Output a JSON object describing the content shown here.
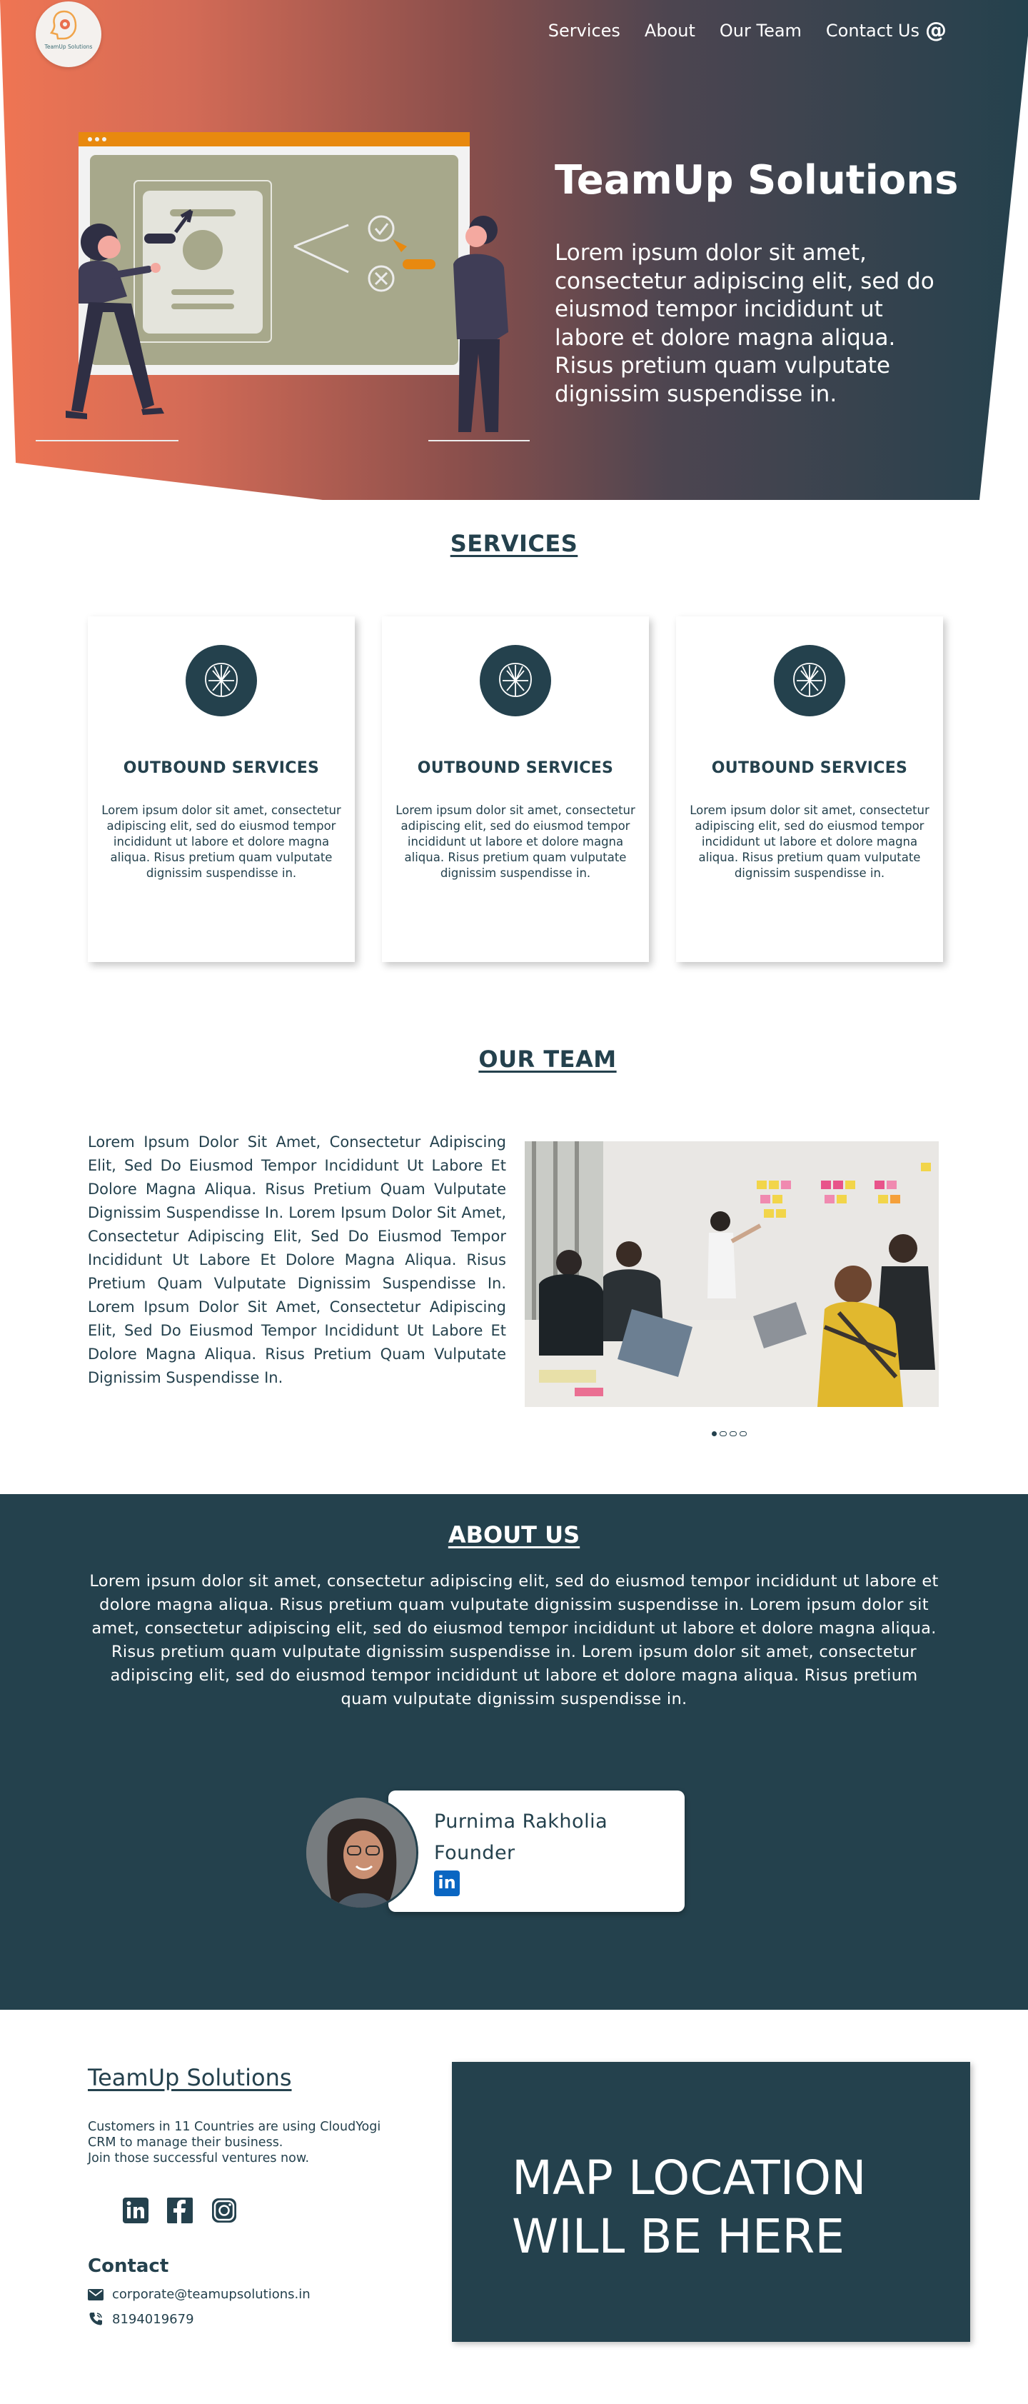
{
  "colors": {
    "primary": "#24414d",
    "accent": "#e96f4f",
    "white": "#ffffff",
    "linkedin": "#0a66c2"
  },
  "brand": {
    "logo_text": "TeamUp Solutions"
  },
  "nav": {
    "items": [
      {
        "label": "Services"
      },
      {
        "label": "About"
      },
      {
        "label": "Our Team"
      },
      {
        "label": "Contact Us"
      }
    ],
    "contact_icon": "at-icon"
  },
  "hero": {
    "title": "TeamUp Solutions",
    "description": "Lorem ipsum dolor sit amet, consectetur adipiscing elit, sed do eiusmod tempor incididunt ut labore et dolore magna aliqua. Risus pretium quam vulputate dignissim suspendisse in."
  },
  "services": {
    "heading": "SERVICES",
    "cards": [
      {
        "icon": "brain-network-icon",
        "title": "OUTBOUND SERVICES",
        "text": "Lorem ipsum dolor sit amet, consectetur adipiscing elit, sed do eiusmod tempor incididunt ut labore et dolore magna aliqua. Risus pretium quam vulputate dignissim suspendisse in."
      },
      {
        "icon": "brain-network-icon",
        "title": "OUTBOUND SERVICES",
        "text": "Lorem ipsum dolor sit amet, consectetur adipiscing elit, sed do eiusmod tempor incididunt ut labore et dolore magna aliqua. Risus pretium quam vulputate dignissim suspendisse in."
      },
      {
        "icon": "brain-network-icon",
        "title": "OUTBOUND SERVICES",
        "text": "Lorem ipsum dolor sit amet, consectetur adipiscing elit, sed do eiusmod tempor incididunt ut labore et dolore magna aliqua. Risus pretium quam vulputate dignissim suspendisse in."
      }
    ]
  },
  "team": {
    "heading": "OUR TEAM",
    "text": "Lorem Ipsum Dolor Sit Amet, Consectetur Adipiscing Elit, Sed Do Eiusmod Tempor Incididunt Ut Labore Et Dolore Magna Aliqua. Risus Pretium Quam Vulputate Dignissim Suspendisse In. Lorem Ipsum Dolor Sit Amet, Consectetur Adipiscing Elit, Sed Do Eiusmod Tempor Incididunt Ut Labore Et Dolore Magna Aliqua. Risus Pretium Quam Vulputate Dignissim Suspendisse In. Lorem Ipsum Dolor Sit Amet, Consectetur Adipiscing Elit, Sed Do Eiusmod Tempor Incididunt Ut Labore Et Dolore Magna Aliqua. Risus Pretium Quam Vulputate Dignissim Suspendisse In.",
    "carousel_slides": 4,
    "carousel_active": 1
  },
  "about": {
    "heading": "ABOUT US",
    "text": "Lorem ipsum dolor sit amet, consectetur adipiscing elit, sed do eiusmod tempor incididunt ut labore et dolore magna aliqua. Risus pretium quam vulputate dignissim suspendisse in. Lorem ipsum dolor sit amet, consectetur adipiscing elit, sed do eiusmod tempor incididunt ut labore et dolore magna aliqua. Risus pretium quam vulputate dignissim suspendisse in. Lorem ipsum dolor sit amet, consectetur adipiscing elit, sed do eiusmod tempor incididunt ut labore et dolore magna aliqua. Risus pretium quam vulputate dignissim suspendisse in.",
    "founder": {
      "name": "Purnima Rakholia",
      "role": "Founder",
      "social_icon": "linkedin-icon",
      "social_label": "in"
    }
  },
  "footer": {
    "brand": "TeamUp Solutions",
    "description": "Customers in 11 Countries are using CloudYogi CRM to manage their business.\nJoin those successful ventures now.",
    "socials": [
      "linkedin-icon",
      "facebook-icon",
      "instagram-icon"
    ],
    "contact_title": "Contact",
    "email": "corporate@teamupsolutions.in",
    "phone": "8194019679",
    "map_text": "MAP LOCATION WILL BE HERE"
  }
}
